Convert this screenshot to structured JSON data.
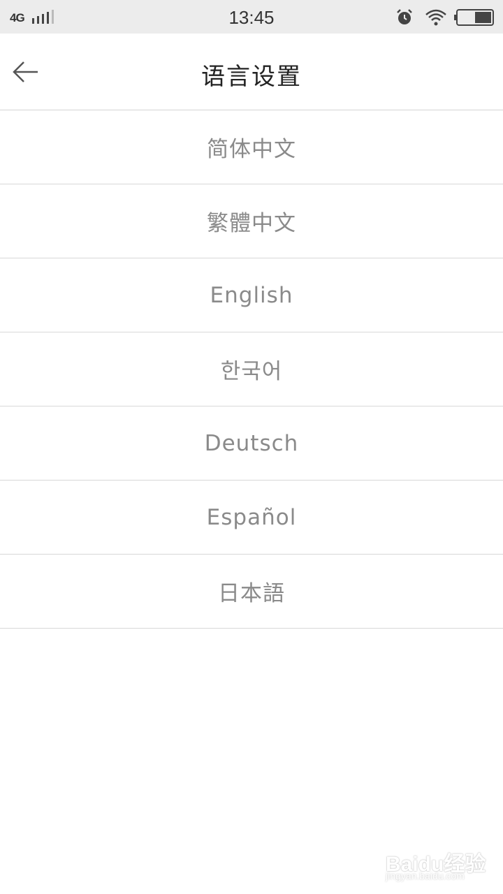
{
  "status_bar": {
    "network": "4G",
    "time": "13:45",
    "icons": [
      "signal-icon",
      "alarm-icon",
      "wifi-icon",
      "battery-icon"
    ]
  },
  "app_bar": {
    "back_icon": "arrow-left-icon",
    "title": "语言设置"
  },
  "languages": [
    {
      "label": "简体中文"
    },
    {
      "label": "繁體中文"
    },
    {
      "label": "English"
    },
    {
      "label": "한국어"
    },
    {
      "label": "Deutsch"
    },
    {
      "label": "Español"
    },
    {
      "label": "日本語"
    }
  ],
  "watermark": {
    "main": "Baidu经验",
    "sub": "jingyan.baidu.com"
  },
  "colors": {
    "status_bar_bg": "#ececec",
    "divider": "#d8d8d8",
    "item_text": "#8a8a8a",
    "title_text": "#222222"
  }
}
